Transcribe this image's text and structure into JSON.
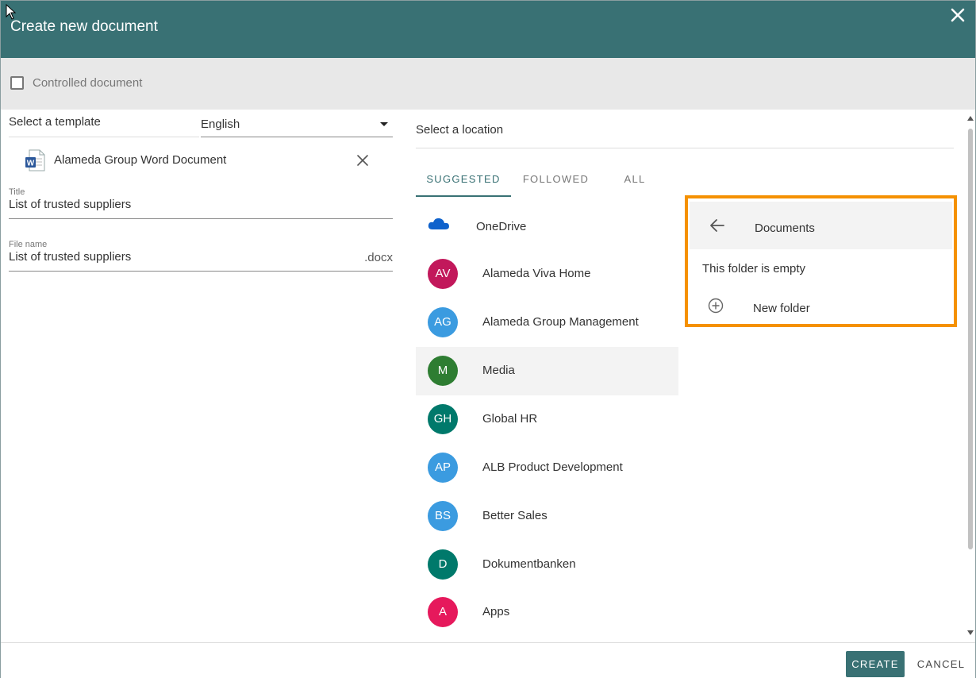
{
  "dialog": {
    "title": "Create new document"
  },
  "controlled": {
    "label": "Controlled document",
    "checked": false
  },
  "template": {
    "label": "Select a template",
    "language": "English",
    "selected_name": "Alameda Group Word Document",
    "icon": "word-document-icon"
  },
  "fields": {
    "title_label": "Title",
    "title_value": "List of trusted suppliers",
    "filename_label": "File name",
    "filename_value": "List of trusted suppliers",
    "filename_ext": ".docx"
  },
  "location": {
    "label": "Select a location",
    "tabs": [
      {
        "label": "SUGGESTED",
        "active": true
      },
      {
        "label": "FOLLOWED",
        "active": false
      },
      {
        "label": "ALL",
        "active": false
      }
    ],
    "sites": [
      {
        "initials": "",
        "name": "OneDrive",
        "color": "#0f62cc",
        "icon": "onedrive-cloud-icon"
      },
      {
        "initials": "AV",
        "name": "Alameda Viva Home",
        "color": "#c2185b"
      },
      {
        "initials": "AG",
        "name": "Alameda Group Management",
        "color": "#3b9be0"
      },
      {
        "initials": "M",
        "name": "Media",
        "color": "#2e7d32",
        "selected": true
      },
      {
        "initials": "GH",
        "name": "Global HR",
        "color": "#00796b"
      },
      {
        "initials": "AP",
        "name": "ALB Product Development",
        "color": "#3b9be0"
      },
      {
        "initials": "BS",
        "name": "Better Sales",
        "color": "#3b9be0"
      },
      {
        "initials": "D",
        "name": "Dokumentbanken",
        "color": "#00796b"
      },
      {
        "initials": "A",
        "name": "Apps",
        "color": "#e6195c"
      }
    ]
  },
  "folder_panel": {
    "title": "Documents",
    "empty_text": "This folder is empty",
    "new_folder_label": "New folder",
    "highlight_color": "#f59100"
  },
  "footer": {
    "create_label": "CREATE",
    "cancel_label": "CANCEL"
  },
  "colors": {
    "header": "#397174",
    "accent": "#397174"
  }
}
